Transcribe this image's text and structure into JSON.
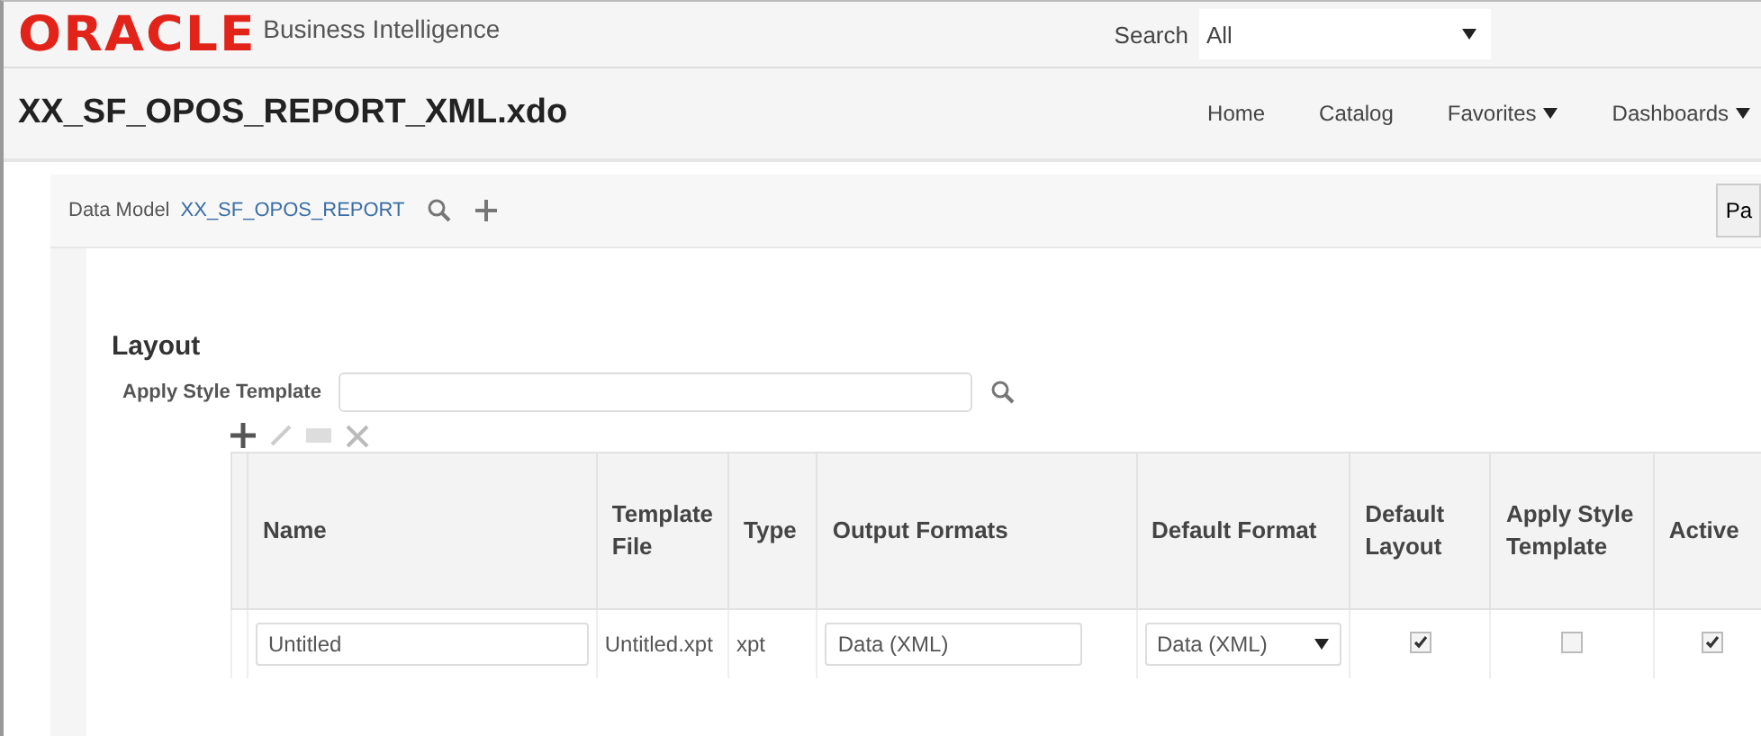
{
  "header": {
    "logo": "ORACLE",
    "product": "Business Intelligence",
    "search_label": "Search",
    "search_scope": "All"
  },
  "title": "XX_SF_OPOS_REPORT_XML.xdo",
  "nav": [
    {
      "label": "Home",
      "menu": false
    },
    {
      "label": "Catalog",
      "menu": false
    },
    {
      "label": "Favorites",
      "menu": true
    },
    {
      "label": "Dashboards",
      "menu": true
    }
  ],
  "data_model": {
    "label": "Data Model",
    "value": "XX_SF_OPOS_REPORT",
    "button": "Pa"
  },
  "layout": {
    "heading": "Layout",
    "style_label": "Apply Style Template",
    "table": {
      "columns": [
        "Name",
        "Template File",
        "Type",
        "Output Formats",
        "Default Format",
        "Default Layout",
        "Apply Style Template",
        "Active"
      ],
      "rows": [
        {
          "name": "Untitled",
          "template_file": "Untitled.xpt",
          "type": "xpt",
          "output_formats": "Data (XML)",
          "default_format": "Data (XML)",
          "default_layout": true,
          "apply_style": false,
          "active": true
        }
      ]
    }
  }
}
